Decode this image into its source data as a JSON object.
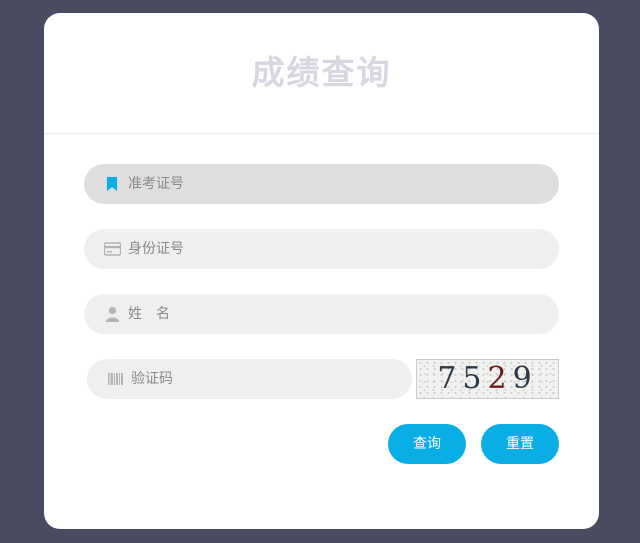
{
  "form": {
    "title": "成绩查询",
    "fields": [
      {
        "placeholder": "准考证号",
        "icon": "bookmark-icon",
        "icon_color": "#0aaee6"
      },
      {
        "placeholder": "身份证号",
        "icon": "id-card-icon"
      },
      {
        "placeholder": "姓　名",
        "icon": "user-icon"
      },
      {
        "placeholder": "验证码",
        "icon": "barcode-icon"
      }
    ],
    "captcha": {
      "code": [
        "7",
        "5",
        "2",
        "9"
      ]
    },
    "buttons": {
      "query": "查询",
      "reset": "重置"
    }
  },
  "colors": {
    "background": "#4a4a60",
    "card": "#ffffff",
    "accent": "#0aaee6",
    "field_bg": "#efefef",
    "field_active_bg": "#dedede",
    "title": "#d7d7e1"
  }
}
